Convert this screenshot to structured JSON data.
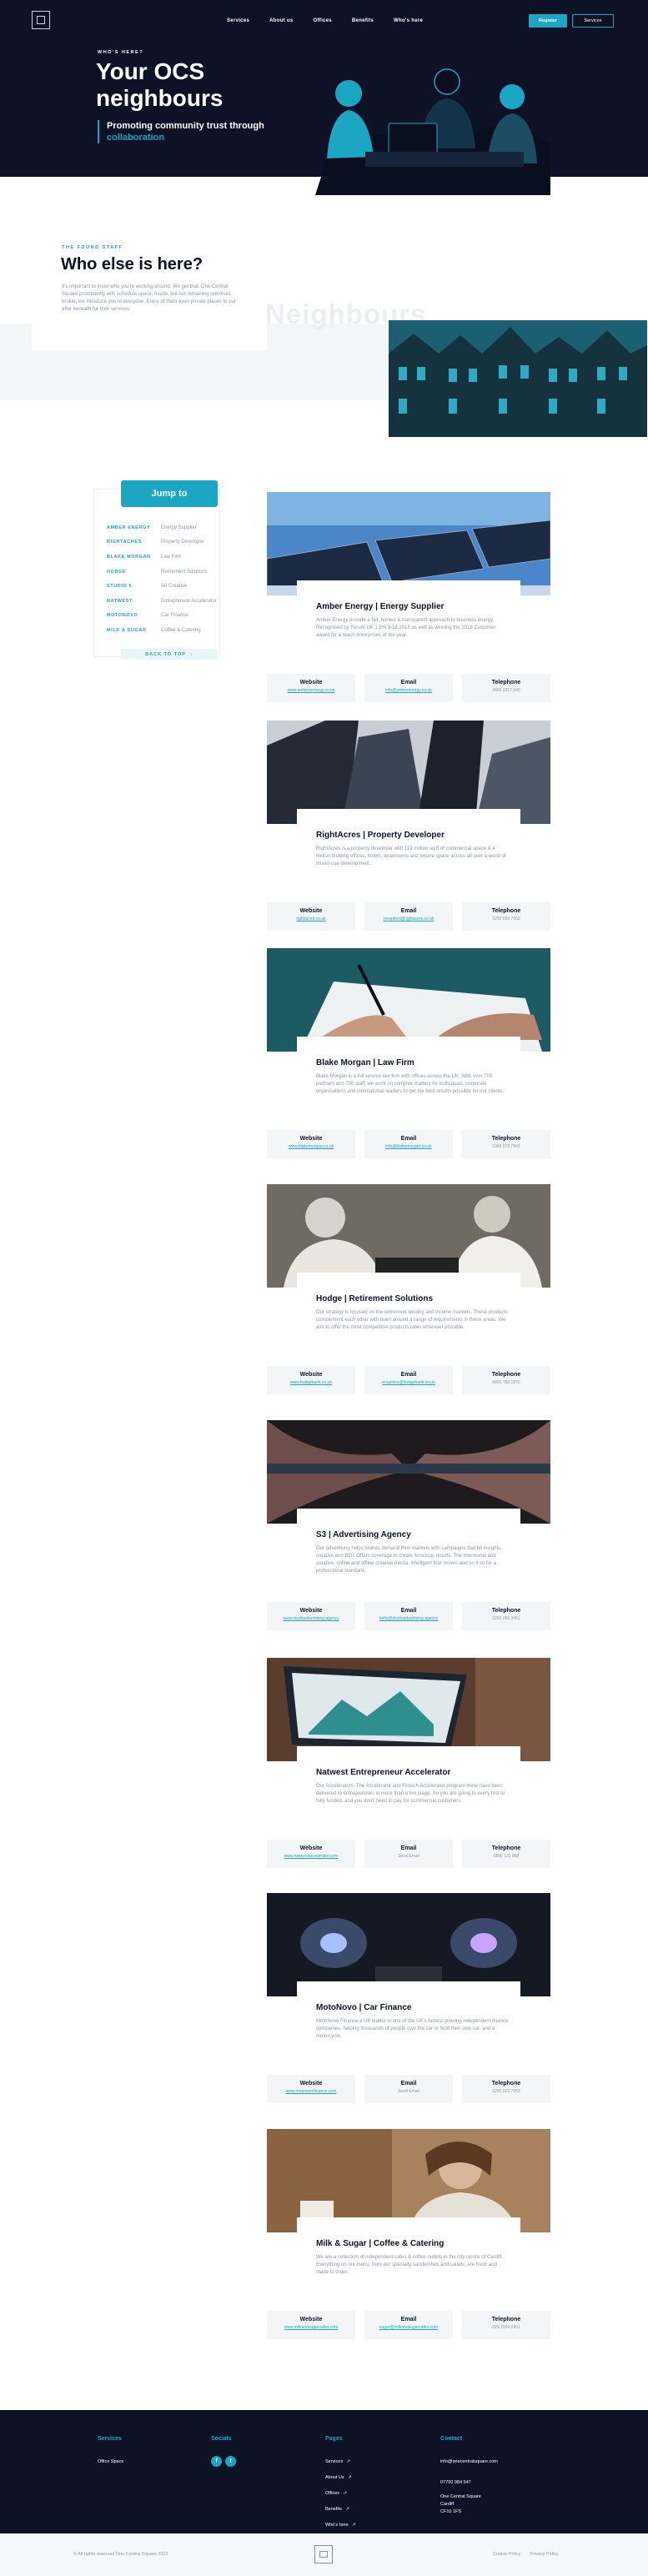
{
  "header": {
    "nav": [
      "Services",
      "About us",
      "Offices",
      "Benefits",
      "Who's here"
    ],
    "register_label": "Register",
    "services_label": "Services"
  },
  "hero": {
    "eyebrow": "WHO'S HERE?",
    "title": "Your OCS neighbours",
    "subtitle_1": "Promoting community trust through",
    "subtitle_2": "collaboration"
  },
  "intro": {
    "eyebrow": "THE FOUND STAFF",
    "title": "Who else is here?",
    "text": "It's important to know who you're working around. We get that. One Central Square prominently with schedule space. Inside, but not remaining premises broker, we introduce you to everyone. Enjoy of them even private places to our after beneath for their services.",
    "watermark": "Neighbours"
  },
  "sidebar": {
    "jump_label": "Jump to",
    "back_label": "BACK TO TOP",
    "items": [
      {
        "company": "AMBER ENERGY",
        "desc": "Energy Supplier"
      },
      {
        "company": "RIGHTACRES",
        "desc": "Property Developer"
      },
      {
        "company": "BLAKE MORGAN",
        "desc": "Law Firm"
      },
      {
        "company": "HODGE",
        "desc": "Retirement Solutions"
      },
      {
        "company": "STUDIO 5",
        "desc": "Ad Creative"
      },
      {
        "company": "NATWEST",
        "desc": "Entrepreneur Accelerator"
      },
      {
        "company": "MOTONOVO",
        "desc": "Car Finance"
      },
      {
        "company": "MILK & SUGAR",
        "desc": "Coffee & Catering"
      }
    ]
  },
  "labels": {
    "website": "Website",
    "email": "Email",
    "telephone": "Telephone"
  },
  "companies": [
    {
      "title": "Amber Energy | Energy Supplier",
      "desc": "Amber Energy provide a fair, honest & transparent approach to business energy. Recognised by Forum UK 1.5% 3-18.2018 as well as winning the 2018 Customer award for a reach enterprises of the year.",
      "website": "www.ambersenergy.co.uk",
      "email": "info@amberenergy.co.uk",
      "telephone": "0800 2317 640"
    },
    {
      "title": "RightAcres | Property Developer",
      "desc": "RightAcres is a property developer with 119 million sq.ft of commercial space & 4 million building offices, hotels, apartments and leisure space across all over a world of mixed-use development.",
      "website": "rightacres.co.uk",
      "email": "reception@rightacres.co.uk",
      "telephone": "0292 032 7650"
    },
    {
      "title": "Blake Morgan | Law Firm",
      "desc": "Blake Morgan is a full service law firm with offices across the UK. With over 700 partners and 700 staff, we work on complex matters for individuals, corporate organisations and international leaders to get the best results possible for our clients.",
      "website": "www.blakemorgan.co.uk",
      "email": "info@blakemorgan.co.uk",
      "telephone": "0345 873 7843"
    },
    {
      "title": "Hodge | Retirement Solutions",
      "desc": "Our strategy is focused on the retirement lending and income markets. These products complement each other with team around a range of requirements in these areas. We aim to offer the most competitive products rates wherever possible.",
      "website": "www.hodgebank.co.uk",
      "email": "enquiries@hodgebank.co.uk",
      "telephone": "0800 783 1870"
    },
    {
      "title": "S3 | Advertising Agency",
      "desc": "Our advertising helps brands demand their markets with campaigns that hit insights, creative and ROI. Offers coverage to create ferocious results. The intentional and creative, online and offline creative media, intelligent that moves and so it so for a professional standard.",
      "website": "www.studioadvertising.agency",
      "email": "hello@studioadvertising.agency",
      "telephone": "0292 066 3461"
    },
    {
      "title": "Natwest Entrepreneur Accelerator",
      "desc": "Our Accelerators. The Accelerator and Fintech Accelerator program there have been delivered to entrepreneurs in more than a ten stage. So you are going to every first to fully funded, and you don't need to pay for commercial customers.",
      "website": "www.natwestaccelerator.com",
      "email": "Send Email",
      "telephone": "0800 121 888"
    },
    {
      "title": "MotoNovo | Car Finance",
      "desc": "MotoNovo Finance a UK leader in one of the UK's fastest growing independent finance companies, helping thousands of people own the car or hold their own car, and a motorcycle.",
      "website": "www.motonovofinance.com",
      "email": "Send Email",
      "telephone": "0292 023 7650"
    },
    {
      "title": "Milk & Sugar | Coffee & Catering",
      "desc": "We are a collection of independent cafes & coffee outlets in the city centre of Cardiff. Everything on our menu, from our specialty sandwiches and salads, are fresh and made to order.",
      "website": "www.milkandsugarcafes.com",
      "email": "sugar@milkandsugarcafes.com",
      "telephone": "029 2034 0401"
    }
  ],
  "footer": {
    "services_head": "Services",
    "services_items": [
      "Office Space"
    ],
    "social_head": "Socials",
    "pages_head": "Pages",
    "pages_items": [
      "Services",
      "About Us",
      "Offices",
      "Benefits",
      "Who's here"
    ],
    "contact_head": "Contact",
    "contact_items": [
      "info@onecentralsquare.com",
      "07700 984 547",
      "One Central Square",
      "Cardiff",
      "CF10 1FS"
    ],
    "copyright": "All rights reserved One Central Square 2022",
    "legal": [
      "Cookie Policy",
      "Privacy Policy"
    ]
  },
  "colors": {
    "navy": "#0d1226",
    "teal": "#1ba6c4",
    "muted_text": "#9096a6",
    "panel_grey": "#f4f5f7"
  }
}
